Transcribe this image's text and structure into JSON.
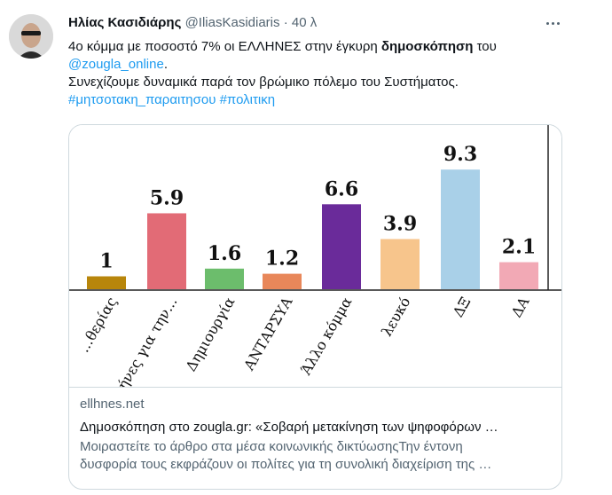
{
  "author": {
    "name": "Ηλίας Κασιδιάρης",
    "handle": "@IliasKasidiaris",
    "separator": "·",
    "time": "40 λ"
  },
  "tweet": {
    "line1_pre": "4ο κόμμα με ποσοστό 7% οι ΕΛΛΗΝΕΣ στην έγκυρη ",
    "line1_bold": "δημοσκόπηση",
    "line1_post": " του",
    "mention": "@zougla_online",
    "mention_suffix": ".",
    "line3": "Συνεχίζουμε δυναμικά παρά τον βρώμικο πόλεμο του Συστήματος.",
    "hashtag1": "#μητσοτακη_παραιτησου",
    "hashtag2": "#πολιτικη"
  },
  "card": {
    "domain": "ellhnes.net",
    "title": "Δημοσκόπηση στο zougla.gr: «Σοβαρή μετακίνηση των ψηφοφόρων …",
    "desc_line1": "Μοιραστείτε το άρθρο στα μέσα κοινωνικής δικτύωσηςΤην έντονη",
    "desc_line2": "δυσφορία τους εκφράζουν οι πολίτες για τη συνολική διαχείριση της …"
  },
  "chart_data": {
    "type": "bar",
    "categories": [
      "...θερίας",
      "...ήνες για την...",
      "Δημιουργία",
      "ΑΝΤΑΡΣΥΑ",
      "Άλλο κόμμα",
      "λευκό",
      "ΔΞ",
      "ΔΑ"
    ],
    "values": [
      1,
      5.9,
      1.6,
      1.2,
      6.6,
      3.9,
      9.3,
      2.1
    ],
    "value_labels": [
      "1",
      "5.9",
      "1.6",
      "1.2",
      "6.6",
      "3.9",
      "9.3",
      "2.1"
    ],
    "colors": [
      "#b8860b",
      "#e26b76",
      "#6cbd6c",
      "#e8875a",
      "#6a2b9a",
      "#f7c58c",
      "#a9d0e8",
      "#f2a9b5"
    ],
    "ylim": [
      0,
      10
    ],
    "grid": false
  }
}
